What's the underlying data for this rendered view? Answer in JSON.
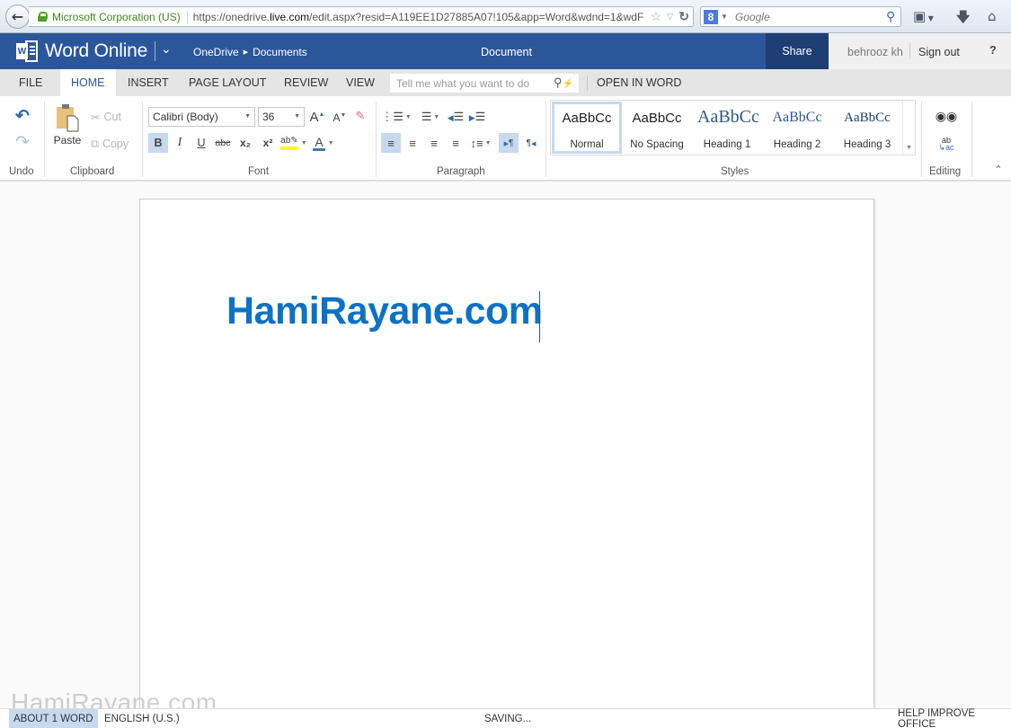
{
  "browser": {
    "identity": "Microsoft Corporation (US)",
    "url_prefix": "https://onedrive.",
    "url_domain": "live.com",
    "url_suffix": "/edit.aspx?resid=A119EE1D27885A07!105&app=Word&wdnd=1&wdF",
    "search_placeholder": "Google",
    "search_engine_icon": "8"
  },
  "header": {
    "app_title": "Word Online",
    "breadcrumb": [
      "OneDrive",
      "Documents"
    ],
    "document_title": "Document",
    "share_label": "Share",
    "user_name": "behrooz kh",
    "sign_out_label": "Sign out",
    "help_label": "?"
  },
  "tabs": [
    {
      "label": "FILE",
      "active": false
    },
    {
      "label": "HOME",
      "active": true
    },
    {
      "label": "INSERT",
      "active": false
    },
    {
      "label": "PAGE LAYOUT",
      "active": false
    },
    {
      "label": "REVIEW",
      "active": false
    },
    {
      "label": "VIEW",
      "active": false
    }
  ],
  "tell_me_placeholder": "Tell me what you want to do",
  "open_in_word_label": "OPEN IN WORD",
  "ribbon": {
    "groups": {
      "undo": "Undo",
      "clipboard": "Clipboard",
      "font": "Font",
      "paragraph": "Paragraph",
      "styles": "Styles",
      "editing": "Editing"
    },
    "clipboard": {
      "paste": "Paste",
      "cut": "Cut",
      "copy": "Copy"
    },
    "font": {
      "font_name": "Calibri (Body)",
      "font_size": "36",
      "bold": "B",
      "italic": "I",
      "underline": "U",
      "strikethrough": "abc",
      "subscript": "x₂",
      "superscript": "x²",
      "highlight_color": "#ffff00",
      "font_color": "#3f78b5",
      "bold_active": true
    },
    "paragraph": {
      "align_left_active": true,
      "ltr_active": true
    },
    "styles": [
      {
        "sample": "AaBbCc",
        "name": "Normal",
        "selected": true
      },
      {
        "sample": "AaBbCc",
        "name": "No Spacing",
        "selected": false
      },
      {
        "sample": "AaBbCc",
        "name": "Heading 1",
        "selected": false
      },
      {
        "sample": "AaBbCc",
        "name": "Heading 2",
        "selected": false
      },
      {
        "sample": "AaBbCc",
        "name": "Heading 3",
        "selected": false
      }
    ]
  },
  "document": {
    "text": "HamiRayane.com",
    "text_color": "#0e72c4"
  },
  "status": {
    "word_count": "ABOUT 1 WORD",
    "language": "ENGLISH (U.S.)",
    "save_state": "SAVING...",
    "help_improve": "HELP IMPROVE OFFICE"
  },
  "watermark": "HamiRayane.com",
  "colors": {
    "brand": "#2b579a",
    "share_bg": "#1e3f73",
    "selection": "#c5d9f1"
  }
}
